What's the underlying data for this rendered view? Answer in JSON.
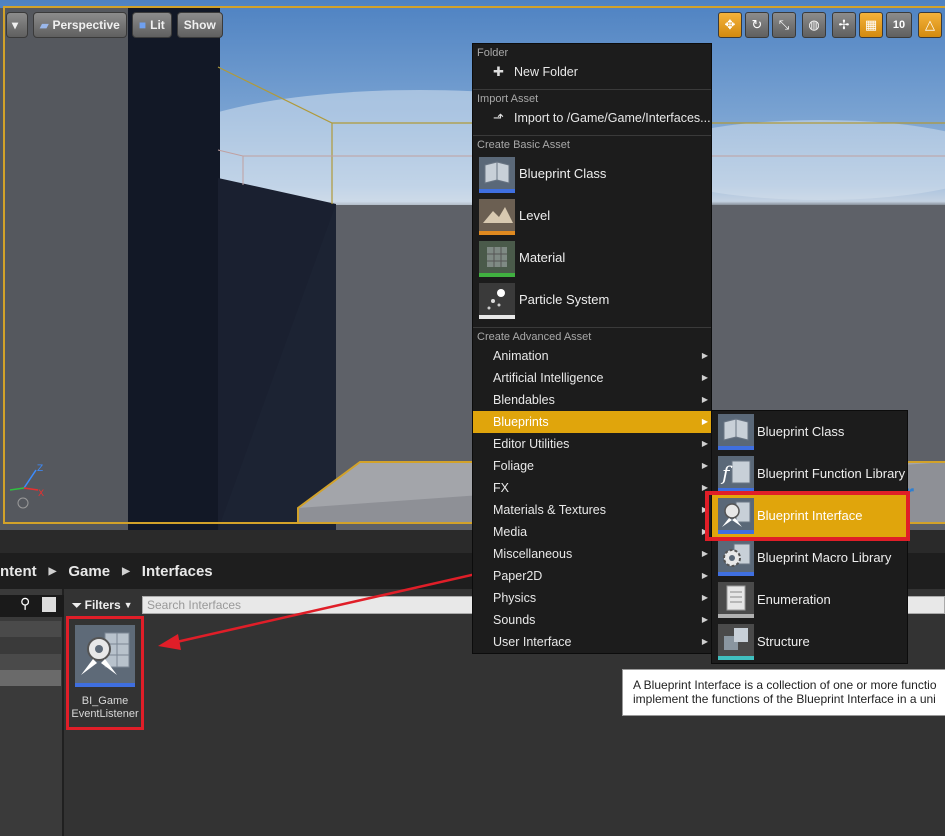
{
  "viewport": {
    "view_mode": "Perspective",
    "lit_label": "Lit",
    "show_label": "Show",
    "grid_snap": "10",
    "axis_z": "Z",
    "axis_x": "X"
  },
  "content_browser": {
    "breadcrumbs": [
      "ntent",
      "Game",
      "Interfaces"
    ],
    "filters_label": "Filters",
    "search_placeholder": "Search Interfaces",
    "asset": {
      "name_line1": "BI_Game",
      "name_line2": "EventListener"
    }
  },
  "context_menu": {
    "sections": {
      "folder": "Folder",
      "import": "Import Asset",
      "basic": "Create Basic Asset",
      "advanced": "Create Advanced Asset"
    },
    "new_folder": "New Folder",
    "import_to": "Import to /Game/Game/Interfaces...",
    "basic_items": [
      "Blueprint Class",
      "Level",
      "Material",
      "Particle System"
    ],
    "advanced_items": [
      "Animation",
      "Artificial Intelligence",
      "Blendables",
      "Blueprints",
      "Editor Utilities",
      "Foliage",
      "FX",
      "Materials & Textures",
      "Media",
      "Miscellaneous",
      "Paper2D",
      "Physics",
      "Sounds",
      "User Interface"
    ],
    "selected_item": "Blueprints"
  },
  "submenu": {
    "items": [
      "Blueprint Class",
      "Blueprint Function Library",
      "Blueprint Interface",
      "Blueprint Macro Library",
      "Enumeration",
      "Structure"
    ],
    "selected_item": "Blueprint Interface"
  },
  "tooltip": {
    "line1": "A Blueprint Interface is a collection of one or more functio",
    "line2": "implement the functions of the Blueprint Interface in a uni"
  },
  "colors": {
    "accent": "#e0a50c",
    "annotation": "#e01e28",
    "menu_bg": "#1c1c1c"
  }
}
